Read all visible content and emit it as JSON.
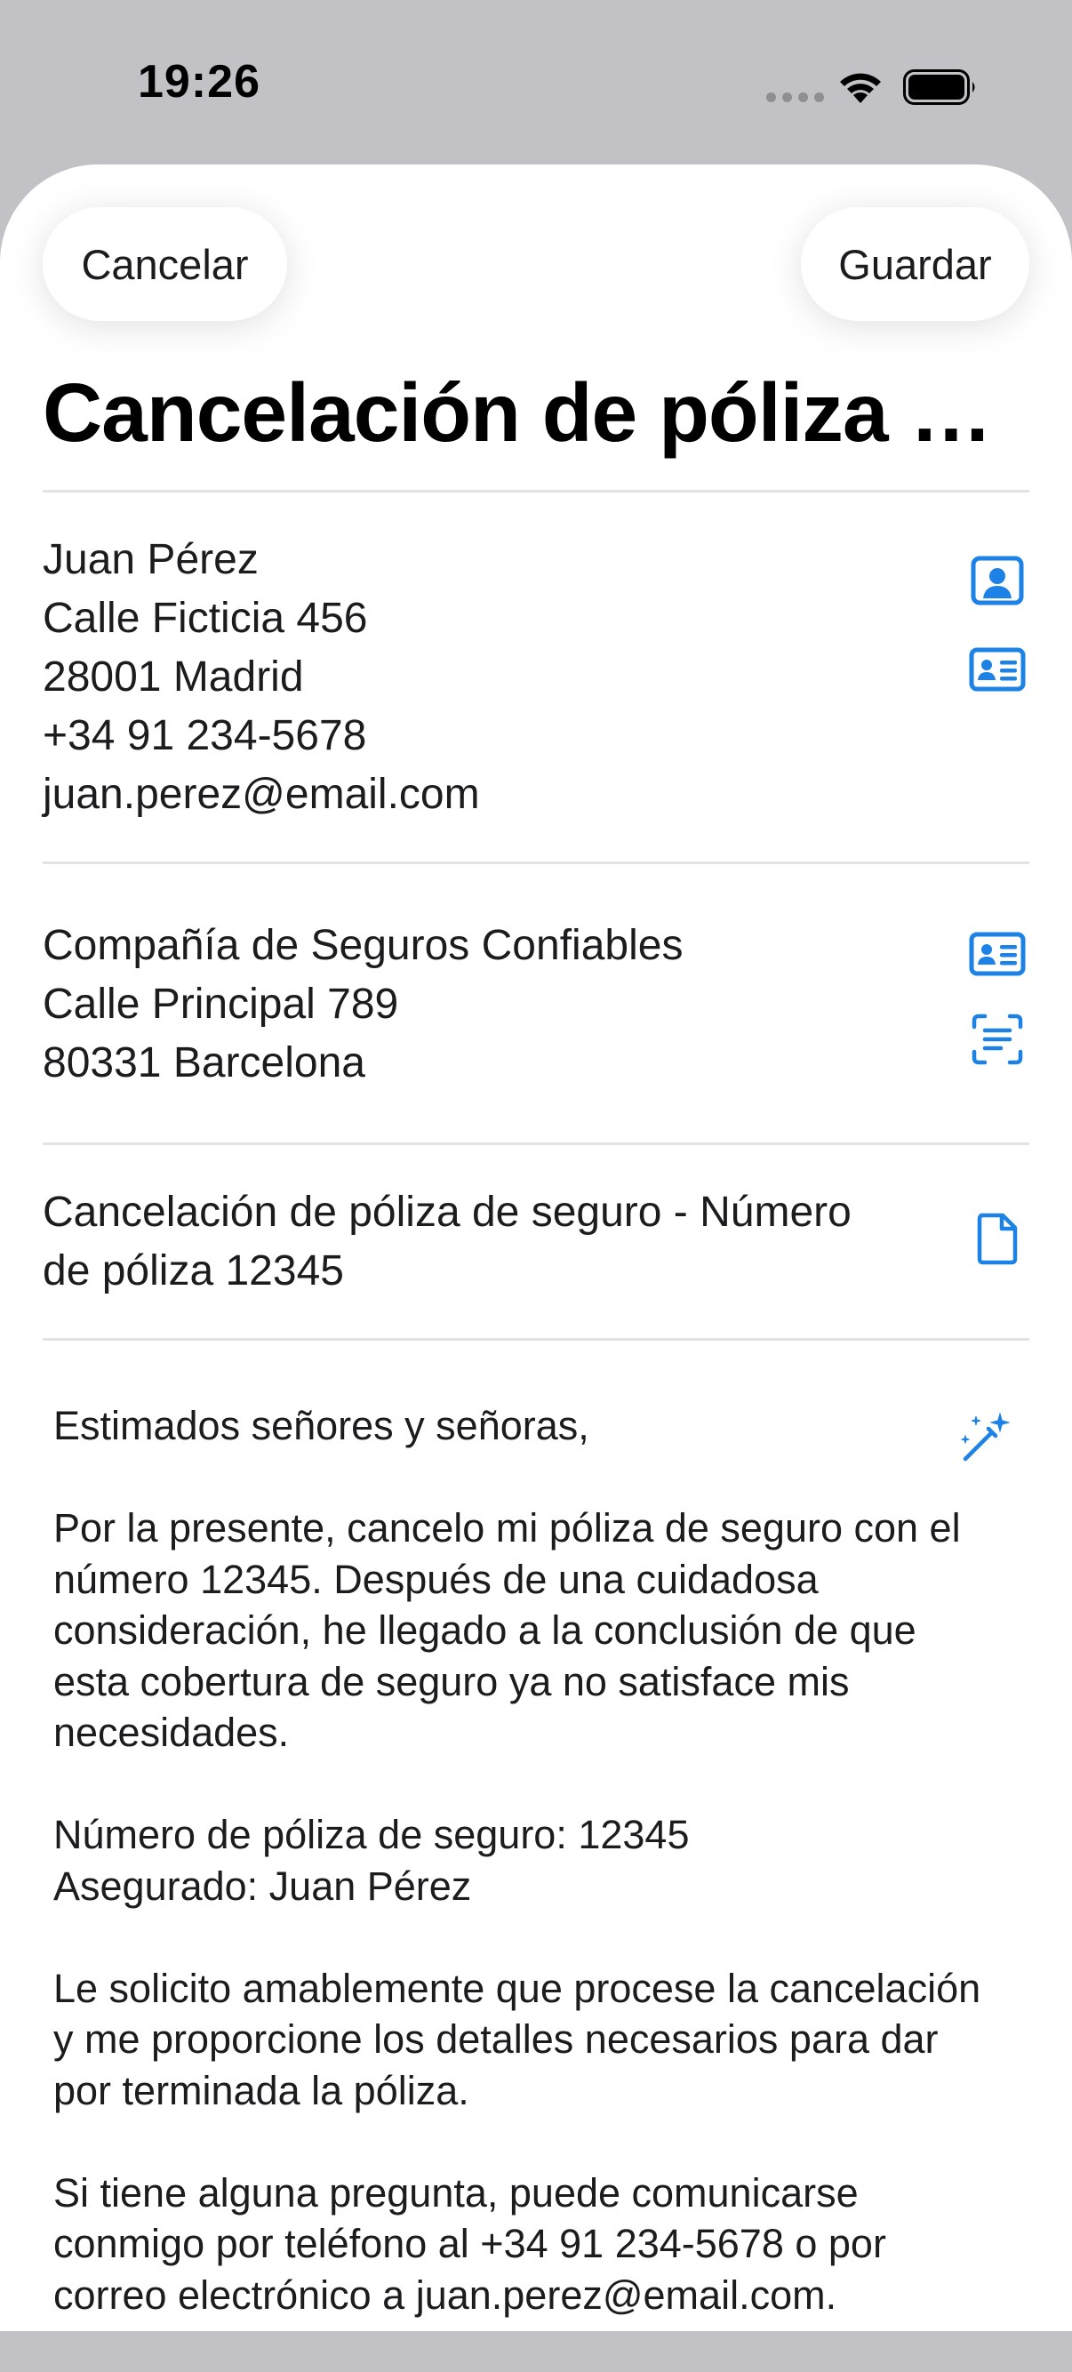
{
  "status_bar": {
    "time": "19:26"
  },
  "nav": {
    "cancel_label": "Cancelar",
    "save_label": "Guardar"
  },
  "title": "Cancelación de póliza de seguro",
  "sender": {
    "lines": [
      "Juan Pérez",
      "Calle Ficticia 456",
      "28001 Madrid",
      "+34 91 234-5678",
      "juan.perez@email.com"
    ]
  },
  "recipient": {
    "lines": [
      "Compañía de Seguros Confiables",
      "Calle Principal 789",
      "80331 Barcelona"
    ]
  },
  "subject": {
    "lines": [
      "Cancelación de póliza de seguro - Número",
      "de póliza 12345"
    ]
  },
  "letter": {
    "paragraphs": [
      "Estimados señores y señoras,",
      "Por la presente, cancelo mi póliza de seguro con el número 12345. Después de una cuidadosa consideración, he llegado a la conclusión de que esta cobertura de seguro ya no satisface mis necesidades.",
      "Número de póliza de seguro: 12345\nAsegurado: Juan Pérez",
      "Le solicito amablemente que procese la cancelación y me proporcione los detalles necesarios para dar por terminada la póliza.",
      "Si tiene alguna pregunta, puede comunicarse conmigo por teléfono al +34 91 234-5678 o por correo electrónico a juan.perez@email.com."
    ]
  },
  "icons": {
    "contact": "person-crop-square-icon",
    "card": "contact-card-icon",
    "scan": "text-scan-icon",
    "document": "document-icon",
    "magic": "magic-wand-icon"
  },
  "colors": {
    "accent": "#1c82e6",
    "status_bg": "#c1c1c6",
    "divider": "#e3e3e6"
  }
}
